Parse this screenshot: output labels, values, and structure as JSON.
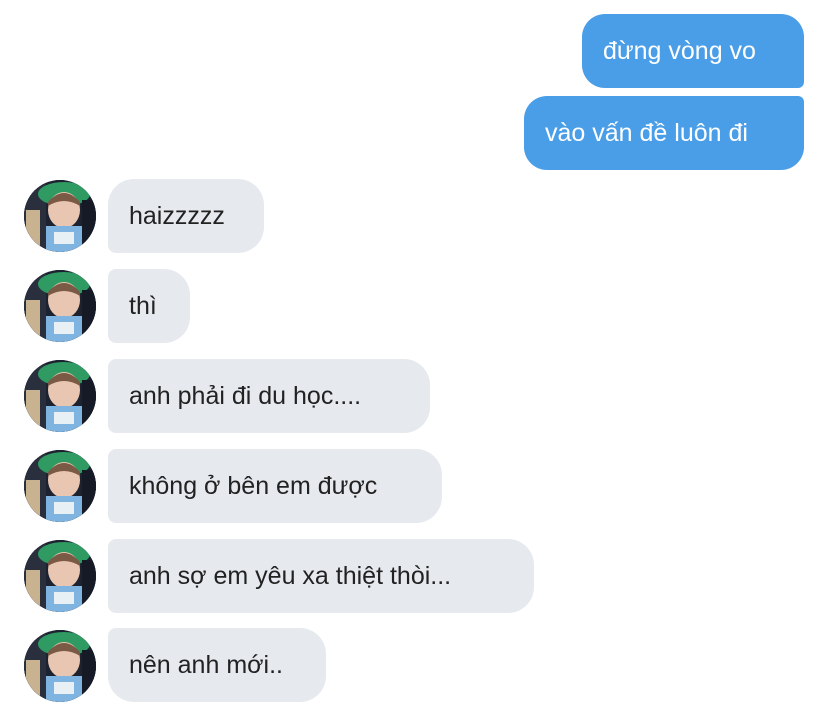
{
  "sent_messages": [
    {
      "text": "đừng vòng vo"
    },
    {
      "text": "vào vấn đề luôn đi"
    }
  ],
  "received_messages": [
    {
      "text": "haizzzzz"
    },
    {
      "text": "thì"
    },
    {
      "text": "anh phải đi du học...."
    },
    {
      "text": "không ở bên em được"
    },
    {
      "text": "anh sợ em yêu xa thiệt thòi..."
    },
    {
      "text": "nên anh mới.."
    }
  ],
  "colors": {
    "sent_bubble": "#4a9ee8",
    "received_bubble": "#e6e9ee",
    "background": "#ffffff"
  },
  "icons": {
    "avatar": "contact-avatar-photo"
  }
}
